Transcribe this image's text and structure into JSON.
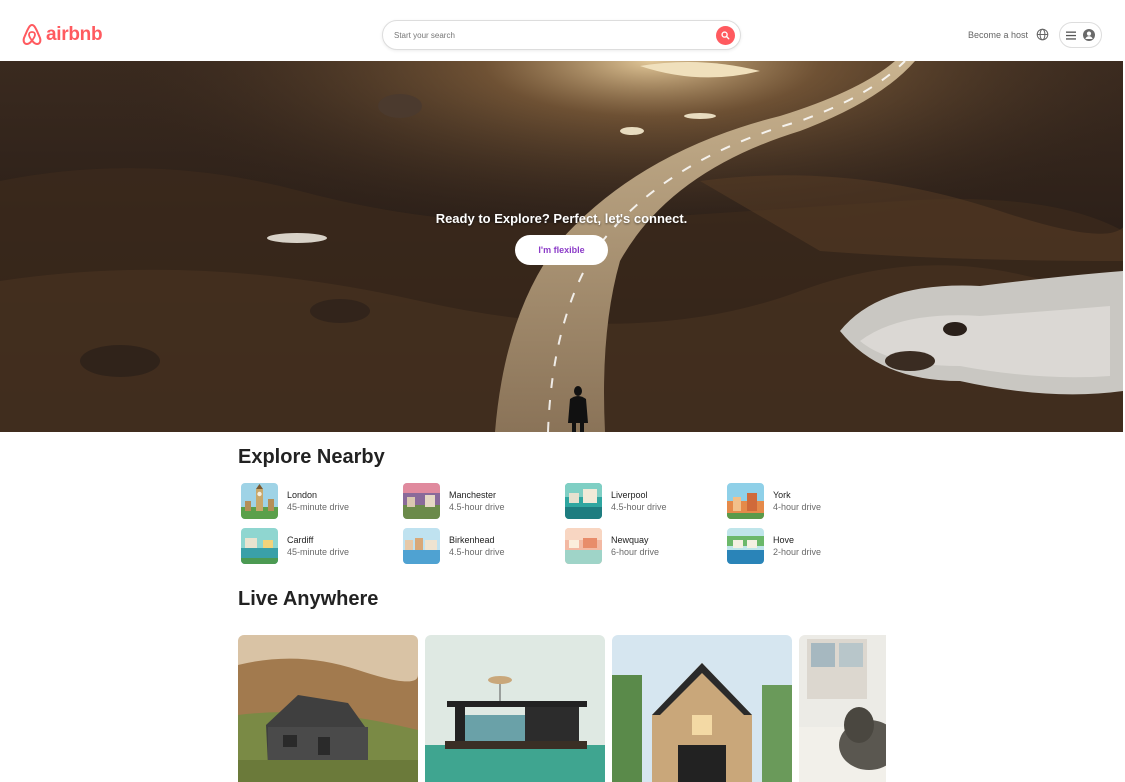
{
  "header": {
    "logo_text": "airbnb",
    "search_placeholder": "Start your search",
    "become_host": "Become a host"
  },
  "hero": {
    "title": "Ready to Explore? Perfect, let's connect.",
    "button": "I'm flexible"
  },
  "explore": {
    "title": "Explore Nearby",
    "items": [
      {
        "name": "London",
        "drive": "45-minute drive"
      },
      {
        "name": "Manchester",
        "drive": "4.5-hour drive"
      },
      {
        "name": "Liverpool",
        "drive": "4.5-hour drive"
      },
      {
        "name": "York",
        "drive": "4-hour drive"
      },
      {
        "name": "Cardiff",
        "drive": "45-minute drive"
      },
      {
        "name": "Birkenhead",
        "drive": "4.5-hour drive"
      },
      {
        "name": "Newquay",
        "drive": "6-hour drive"
      },
      {
        "name": "Hove",
        "drive": "2-hour drive"
      }
    ]
  },
  "live": {
    "title": "Live Anywhere"
  },
  "colors": {
    "brand": "#FF5A5F",
    "flexible_text": "#8c3cc8"
  }
}
